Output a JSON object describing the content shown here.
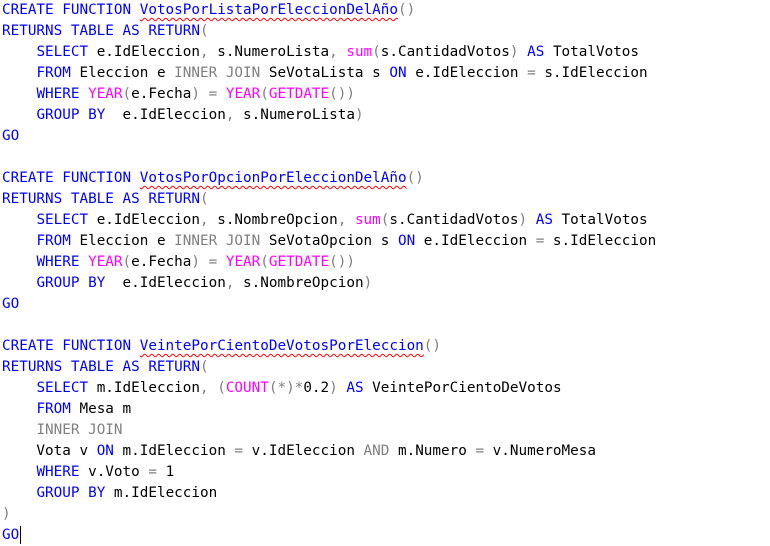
{
  "editor": {
    "colors": {
      "keyword": "#0000ff",
      "function": "#ff00ff",
      "operator": "#808080",
      "text": "#000000",
      "error_squiggle": "#ff0000"
    },
    "lines": [
      [
        [
          "kw",
          "CREATE FUNCTION"
        ],
        [
          "tx",
          " "
        ],
        [
          "sq",
          "VotosPorListaPorEleccionDelAño"
        ],
        [
          "op",
          "()"
        ]
      ],
      [
        [
          "kw",
          "RETURNS TABLE AS RETURN"
        ],
        [
          "op",
          "("
        ]
      ],
      [
        [
          "tx",
          "    "
        ],
        [
          "kw",
          "SELECT"
        ],
        [
          "tx",
          " e.IdEleccion"
        ],
        [
          "op",
          ","
        ],
        [
          "tx",
          " s.NumeroLista"
        ],
        [
          "op",
          ","
        ],
        [
          "tx",
          " "
        ],
        [
          "fn",
          "sum"
        ],
        [
          "op",
          "("
        ],
        [
          "tx",
          "s.CantidadVotos"
        ],
        [
          "op",
          ")"
        ],
        [
          "tx",
          " "
        ],
        [
          "kw",
          "AS"
        ],
        [
          "tx",
          " TotalVotos"
        ]
      ],
      [
        [
          "tx",
          "    "
        ],
        [
          "kw",
          "FROM"
        ],
        [
          "tx",
          " Eleccion e "
        ],
        [
          "op",
          "INNER JOIN"
        ],
        [
          "tx",
          " SeVotaLista s "
        ],
        [
          "kw",
          "ON"
        ],
        [
          "tx",
          " e.IdEleccion "
        ],
        [
          "op",
          "="
        ],
        [
          "tx",
          " s.IdEleccion"
        ]
      ],
      [
        [
          "tx",
          "    "
        ],
        [
          "kw",
          "WHERE"
        ],
        [
          "tx",
          " "
        ],
        [
          "fn",
          "YEAR"
        ],
        [
          "op",
          "("
        ],
        [
          "tx",
          "e.Fecha"
        ],
        [
          "op",
          ")"
        ],
        [
          "tx",
          " "
        ],
        [
          "op",
          "="
        ],
        [
          "tx",
          " "
        ],
        [
          "fn",
          "YEAR"
        ],
        [
          "op",
          "("
        ],
        [
          "fn",
          "GETDATE"
        ],
        [
          "op",
          "())"
        ]
      ],
      [
        [
          "tx",
          "    "
        ],
        [
          "kw",
          "GROUP BY"
        ],
        [
          "tx",
          "  e.IdEleccion"
        ],
        [
          "op",
          ","
        ],
        [
          "tx",
          " s.NumeroLista"
        ],
        [
          "op",
          ")"
        ]
      ],
      [
        [
          "kw",
          "GO"
        ]
      ],
      [],
      [
        [
          "kw",
          "CREATE FUNCTION"
        ],
        [
          "tx",
          " "
        ],
        [
          "sq",
          "VotosPorOpcionPorEleccionDelAño"
        ],
        [
          "op",
          "()"
        ]
      ],
      [
        [
          "kw",
          "RETURNS TABLE AS RETURN"
        ],
        [
          "op",
          "("
        ]
      ],
      [
        [
          "tx",
          "    "
        ],
        [
          "kw",
          "SELECT"
        ],
        [
          "tx",
          " e.IdEleccion"
        ],
        [
          "op",
          ","
        ],
        [
          "tx",
          " s.NombreOpcion"
        ],
        [
          "op",
          ","
        ],
        [
          "tx",
          " "
        ],
        [
          "fn",
          "sum"
        ],
        [
          "op",
          "("
        ],
        [
          "tx",
          "s.CantidadVotos"
        ],
        [
          "op",
          ")"
        ],
        [
          "tx",
          " "
        ],
        [
          "kw",
          "AS"
        ],
        [
          "tx",
          " TotalVotos"
        ]
      ],
      [
        [
          "tx",
          "    "
        ],
        [
          "kw",
          "FROM"
        ],
        [
          "tx",
          " Eleccion e "
        ],
        [
          "op",
          "INNER JOIN"
        ],
        [
          "tx",
          " SeVotaOpcion s "
        ],
        [
          "kw",
          "ON"
        ],
        [
          "tx",
          " e.IdEleccion "
        ],
        [
          "op",
          "="
        ],
        [
          "tx",
          " s.IdEleccion"
        ]
      ],
      [
        [
          "tx",
          "    "
        ],
        [
          "kw",
          "WHERE"
        ],
        [
          "tx",
          " "
        ],
        [
          "fn",
          "YEAR"
        ],
        [
          "op",
          "("
        ],
        [
          "tx",
          "e.Fecha"
        ],
        [
          "op",
          ")"
        ],
        [
          "tx",
          " "
        ],
        [
          "op",
          "="
        ],
        [
          "tx",
          " "
        ],
        [
          "fn",
          "YEAR"
        ],
        [
          "op",
          "("
        ],
        [
          "fn",
          "GETDATE"
        ],
        [
          "op",
          "())"
        ]
      ],
      [
        [
          "tx",
          "    "
        ],
        [
          "kw",
          "GROUP BY"
        ],
        [
          "tx",
          "  e.IdEleccion"
        ],
        [
          "op",
          ","
        ],
        [
          "tx",
          " s.NombreOpcion"
        ],
        [
          "op",
          ")"
        ]
      ],
      [
        [
          "kw",
          "GO"
        ]
      ],
      [],
      [
        [
          "kw",
          "CREATE FUNCTION"
        ],
        [
          "tx",
          " "
        ],
        [
          "sq",
          "VeintePorCientoDeVotosPorEleccion"
        ],
        [
          "op",
          "()"
        ]
      ],
      [
        [
          "kw",
          "RETURNS TABLE AS RETURN"
        ],
        [
          "op",
          "("
        ]
      ],
      [
        [
          "tx",
          "    "
        ],
        [
          "kw",
          "SELECT"
        ],
        [
          "tx",
          " m.IdEleccion"
        ],
        [
          "op",
          ","
        ],
        [
          "tx",
          " "
        ],
        [
          "op",
          "("
        ],
        [
          "fn",
          "COUNT"
        ],
        [
          "op",
          "(*)*"
        ],
        [
          "tx",
          "0.2"
        ],
        [
          "op",
          ")"
        ],
        [
          "tx",
          " "
        ],
        [
          "kw",
          "AS"
        ],
        [
          "tx",
          " VeintePorCientoDeVotos"
        ]
      ],
      [
        [
          "tx",
          "    "
        ],
        [
          "kw",
          "FROM"
        ],
        [
          "tx",
          " Mesa m"
        ]
      ],
      [
        [
          "tx",
          "    "
        ],
        [
          "op",
          "INNER JOIN"
        ]
      ],
      [
        [
          "tx",
          "    Vota v "
        ],
        [
          "kw",
          "ON"
        ],
        [
          "tx",
          " m.IdEleccion "
        ],
        [
          "op",
          "="
        ],
        [
          "tx",
          " v.IdEleccion "
        ],
        [
          "op",
          "AND"
        ],
        [
          "tx",
          " m.Numero "
        ],
        [
          "op",
          "="
        ],
        [
          "tx",
          " v.NumeroMesa"
        ]
      ],
      [
        [
          "tx",
          "    "
        ],
        [
          "kw",
          "WHERE"
        ],
        [
          "tx",
          " v.Voto "
        ],
        [
          "op",
          "="
        ],
        [
          "tx",
          " 1"
        ]
      ],
      [
        [
          "tx",
          "    "
        ],
        [
          "kw",
          "GROUP BY"
        ],
        [
          "tx",
          " m.IdEleccion"
        ]
      ],
      [
        [
          "op",
          ")"
        ]
      ],
      [
        [
          "kw",
          "GO"
        ],
        [
          "caret",
          ""
        ]
      ]
    ]
  }
}
